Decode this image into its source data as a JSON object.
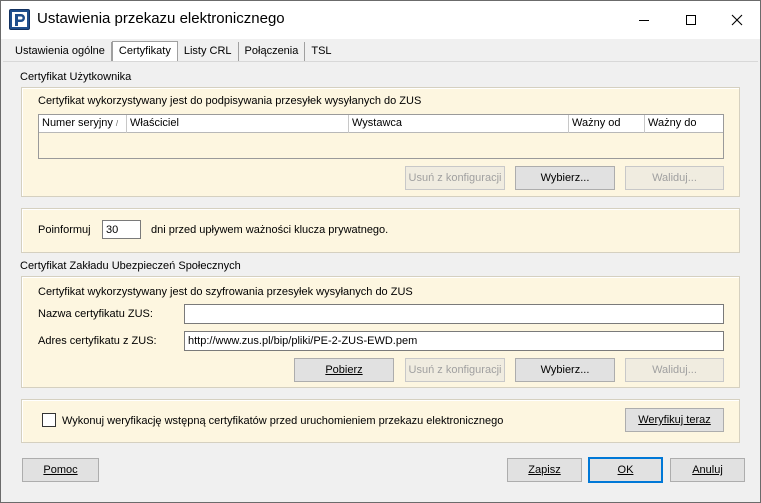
{
  "window": {
    "title": "Ustawienia przekazu elektronicznego",
    "app_icon_letter": "P"
  },
  "tabs": [
    {
      "label": "Ustawienia ogólne",
      "active": false
    },
    {
      "label": "Certyfikaty",
      "active": true
    },
    {
      "label": "Listy CRL",
      "active": false
    },
    {
      "label": "Połączenia",
      "active": false
    },
    {
      "label": "TSL",
      "active": false
    }
  ],
  "user_cert": {
    "section_label": "Certyfikat Użytkownika",
    "description": "Certyfikat wykorzystywany jest do podpisywania przesyłek wysyłanych do ZUS",
    "columns": [
      "Numer seryjny",
      "Właściciel",
      "Wystawca",
      "Ważny od",
      "Ważny do"
    ],
    "sort_indicator": "/",
    "rows": [],
    "buttons": {
      "remove": "Usuń z konfiguracji",
      "choose": "Wybierz...",
      "validate": "Waliduj..."
    }
  },
  "notify": {
    "prefix": "Poinformuj",
    "days_value": "30",
    "suffix": "dni przed upływem ważności klucza prywatnego."
  },
  "zus_cert": {
    "section_label": "Certyfikat Zakładu Ubezpieczeń Społecznych",
    "description": "Certyfikat wykorzystywany jest do szyfrowania przesyłek wysyłanych do ZUS",
    "name_label": "Nazwa certyfikatu ZUS:",
    "name_value": "",
    "address_label": "Adres certyfikatu z ZUS:",
    "address_value": "http://www.zus.pl/bip/pliki/PE-2-ZUS-EWD.pem",
    "buttons": {
      "download": "Pobierz",
      "remove": "Usuń z konfiguracji",
      "choose": "Wybierz...",
      "validate": "Waliduj..."
    }
  },
  "verify": {
    "checkbox_label": "Wykonuj weryfikację wstępną certyfikatów przed uruchomieniem przekazu elektronicznego",
    "checked": false,
    "button": "Weryfikuj teraz"
  },
  "footer": {
    "help": "Pomoc",
    "save": "Zapisz",
    "ok": "OK",
    "cancel": "Anuluj"
  },
  "colors": {
    "panel_bg": "#fdf6e0",
    "window_bg": "#f0f0f0",
    "accent": "#0078d7"
  }
}
